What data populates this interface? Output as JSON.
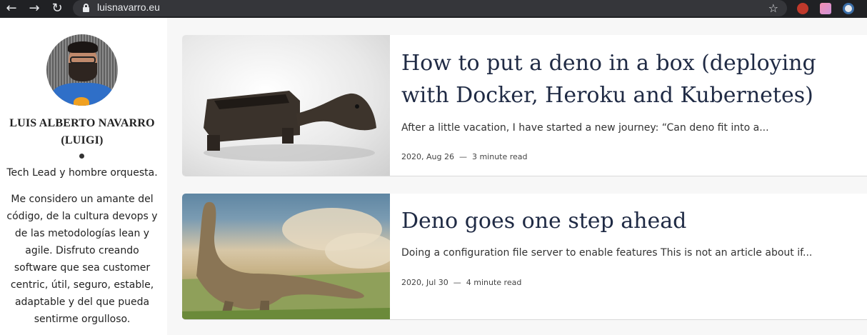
{
  "browser": {
    "url": "luisnavarro.eu",
    "back_icon": "←",
    "forward_icon": "→",
    "reload_icon": "↻",
    "star_icon": "☆"
  },
  "sidebar": {
    "name": "LUIS ALBERTO NAVARRO (LUIGI)",
    "tagline": "Tech Lead y hombre orquesta.",
    "bio": "Me considero un amante del código, de la cultura devops y de las metodologías lean y agile. Disfruto creando software que sea customer centric, útil, seguro, estable, adaptable y del que pueda sentirme orgulloso."
  },
  "posts": [
    {
      "title": "How to put a deno in a box (deploying with Docker, Heroku and Kubernetes)",
      "excerpt": "After a little vacation, I have started a new journey: “Can deno fit into a...",
      "date": "2020, Aug 26",
      "separator": "—",
      "read_time": "3 minute read"
    },
    {
      "title": "Deno goes one step ahead",
      "excerpt": "Doing a configuration file server to enable features This is not an article about if...",
      "date": "2020, Jul 30",
      "separator": "—",
      "read_time": "4 minute read"
    }
  ],
  "colors": {
    "chrome": "#202124",
    "title": "#1f2a44",
    "page_bg": "#f7f7f7"
  }
}
